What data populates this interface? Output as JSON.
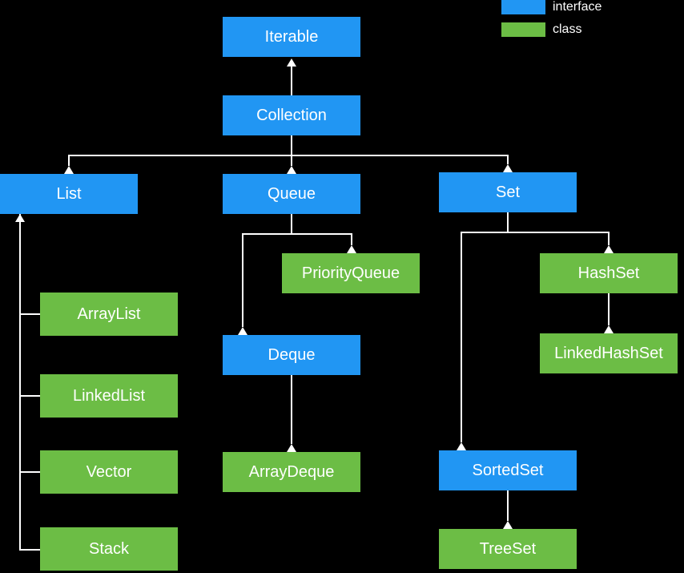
{
  "legend": {
    "interface_label": "interface",
    "class_label": "class"
  },
  "nodes": {
    "iterable": {
      "label": "Iterable",
      "type": "interface"
    },
    "collection": {
      "label": "Collection",
      "type": "interface"
    },
    "list": {
      "label": "List",
      "type": "interface"
    },
    "queue": {
      "label": "Queue",
      "type": "interface"
    },
    "set": {
      "label": "Set",
      "type": "interface"
    },
    "deque": {
      "label": "Deque",
      "type": "interface"
    },
    "sortedset": {
      "label": "SortedSet",
      "type": "interface"
    },
    "arraylist": {
      "label": "ArrayList",
      "type": "class"
    },
    "linkedlist": {
      "label": "LinkedList",
      "type": "class"
    },
    "vector": {
      "label": "Vector",
      "type": "class"
    },
    "stack": {
      "label": "Stack",
      "type": "class"
    },
    "priorityqueue": {
      "label": "PriorityQueue",
      "type": "class"
    },
    "arraydeque": {
      "label": "ArrayDeque",
      "type": "class"
    },
    "hashset": {
      "label": "HashSet",
      "type": "class"
    },
    "linkedhashset": {
      "label": "LinkedHashSet",
      "type": "class"
    },
    "treeset": {
      "label": "TreeSet",
      "type": "class"
    }
  },
  "colors": {
    "interface": "#2196f3",
    "class": "#6cbd45",
    "background": "#000000",
    "connector": "#ffffff"
  },
  "edges": [
    [
      "Collection",
      "Iterable"
    ],
    [
      "List",
      "Collection"
    ],
    [
      "Queue",
      "Collection"
    ],
    [
      "Set",
      "Collection"
    ],
    [
      "ArrayList",
      "List"
    ],
    [
      "LinkedList",
      "List"
    ],
    [
      "Vector",
      "List"
    ],
    [
      "Stack",
      "List"
    ],
    [
      "PriorityQueue",
      "Queue"
    ],
    [
      "Deque",
      "Queue"
    ],
    [
      "ArrayDeque",
      "Deque"
    ],
    [
      "HashSet",
      "Set"
    ],
    [
      "LinkedHashSet",
      "HashSet"
    ],
    [
      "SortedSet",
      "Set"
    ],
    [
      "TreeSet",
      "SortedSet"
    ]
  ]
}
